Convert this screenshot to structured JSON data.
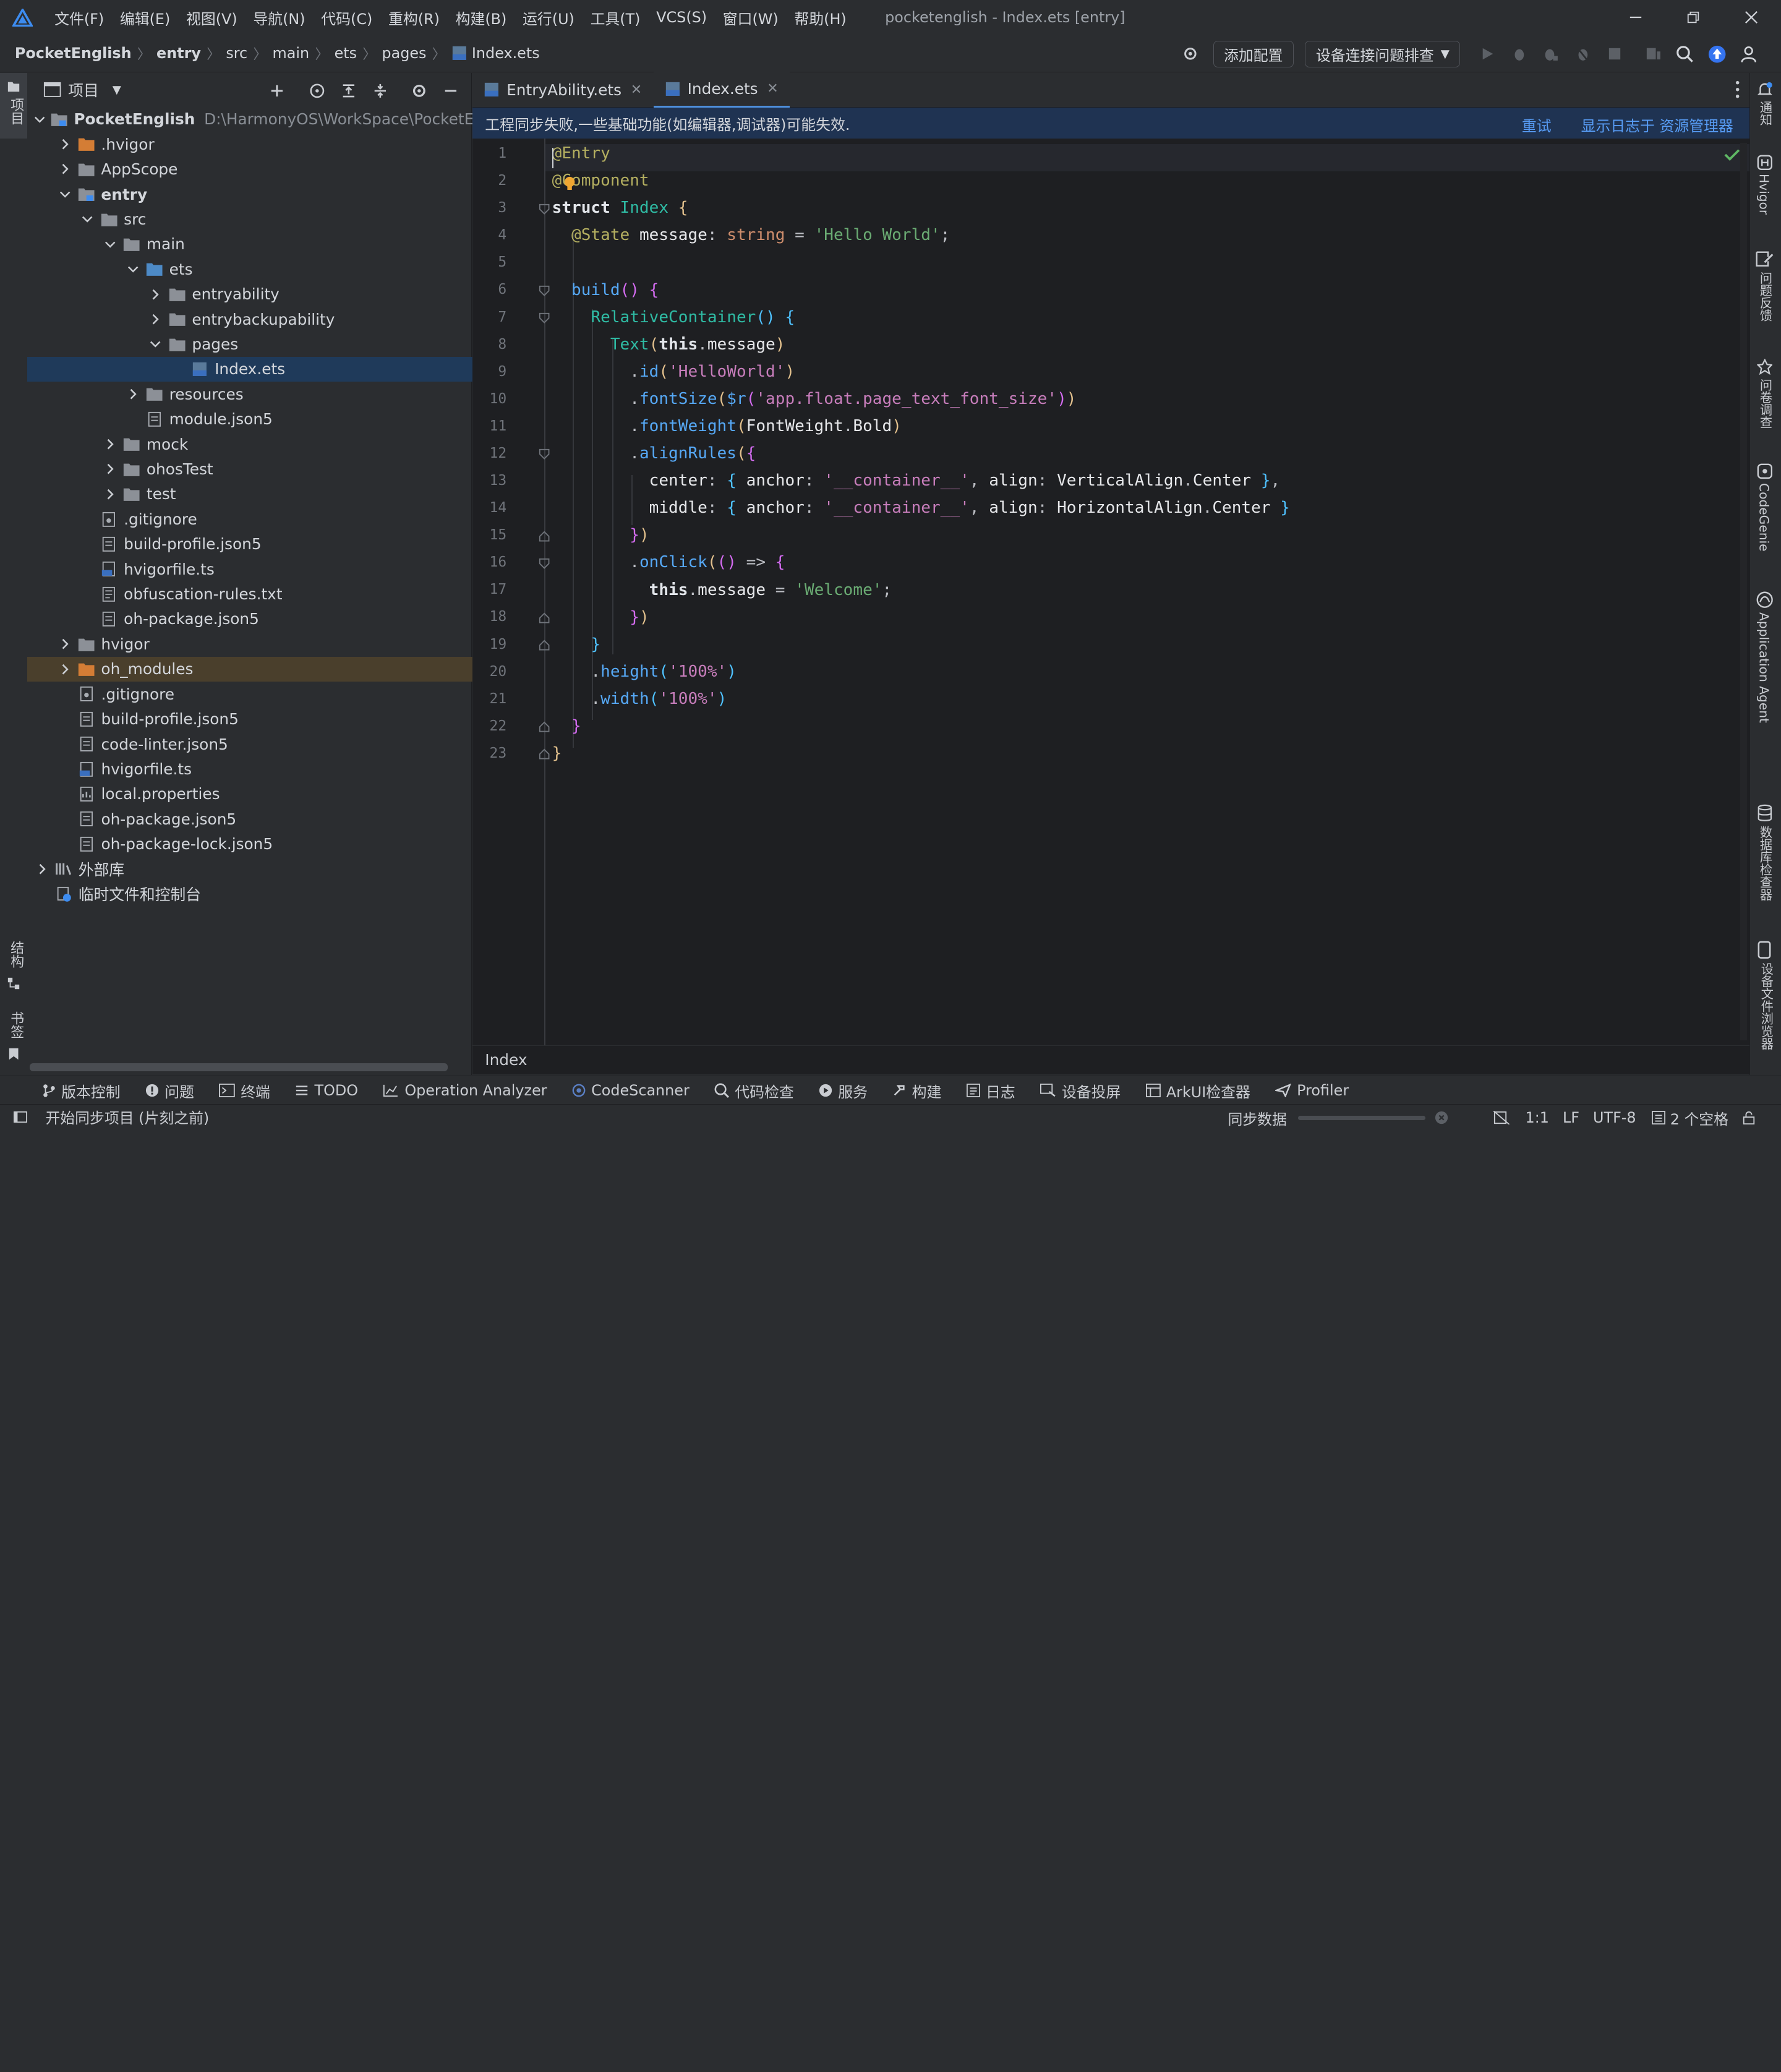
{
  "window": {
    "title": "pocketenglish - Index.ets [entry]"
  },
  "menu": [
    "文件(F)",
    "编辑(E)",
    "视图(V)",
    "导航(N)",
    "代码(C)",
    "重构(R)",
    "构建(B)",
    "运行(U)",
    "工具(T)",
    "VCS(S)",
    "窗口(W)",
    "帮助(H)"
  ],
  "breadcrumb": [
    "PocketEnglish",
    "entry",
    "src",
    "main",
    "ets",
    "pages",
    "Index.ets"
  ],
  "toolbar": {
    "add_config": "添加配置",
    "device_troubleshoot": "设备连接问题排查"
  },
  "left_strip": {
    "project": "项目",
    "structure": "结构",
    "bookmarks": "书签"
  },
  "project_panel": {
    "title": "项目",
    "tree": [
      {
        "label": "PocketEnglish",
        "path": "D:\\HarmonyOS\\WorkSpace\\PocketEngl"
      },
      {
        "label": ".hvigor"
      },
      {
        "label": "AppScope"
      },
      {
        "label": "entry"
      },
      {
        "label": "src"
      },
      {
        "label": "main"
      },
      {
        "label": "ets"
      },
      {
        "label": "entryability"
      },
      {
        "label": "entrybackupability"
      },
      {
        "label": "pages"
      },
      {
        "label": "Index.ets"
      },
      {
        "label": "resources"
      },
      {
        "label": "module.json5"
      },
      {
        "label": "mock"
      },
      {
        "label": "ohosTest"
      },
      {
        "label": "test"
      },
      {
        "label": ".gitignore"
      },
      {
        "label": "build-profile.json5"
      },
      {
        "label": "hvigorfile.ts"
      },
      {
        "label": "obfuscation-rules.txt"
      },
      {
        "label": "oh-package.json5"
      },
      {
        "label": "hvigor"
      },
      {
        "label": "oh_modules"
      },
      {
        "label": ".gitignore"
      },
      {
        "label": "build-profile.json5"
      },
      {
        "label": "code-linter.json5"
      },
      {
        "label": "hvigorfile.ts"
      },
      {
        "label": "local.properties"
      },
      {
        "label": "oh-package.json5"
      },
      {
        "label": "oh-package-lock.json5"
      },
      {
        "label": "外部库"
      },
      {
        "label": "临时文件和控制台"
      }
    ]
  },
  "tabs": [
    {
      "label": "EntryAbility.ets"
    },
    {
      "label": "Index.ets"
    }
  ],
  "notice": {
    "text": "工程同步失败,一些基础功能(如编辑器,调试器)可能失效.",
    "retry": "重试",
    "show_log": "显示日志于 资源管理器"
  },
  "editor": {
    "line_numbers": [
      "1",
      "2",
      "3",
      "4",
      "5",
      "6",
      "7",
      "8",
      "9",
      "10",
      "11",
      "12",
      "13",
      "14",
      "15",
      "16",
      "17",
      "18",
      "19",
      "20",
      "21",
      "22",
      "23"
    ],
    "footer_crumb": "Index"
  },
  "right_strip": [
    "通知",
    "Hvigor",
    "问题反馈",
    "问卷调查",
    "CodeGenie",
    "Application Agent",
    "数据库检查器",
    "设备文件浏览器"
  ],
  "bottom_tools": [
    "版本控制",
    "问题",
    "终端",
    "TODO",
    "Operation Analyzer",
    "CodeScanner",
    "代码检查",
    "服务",
    "构建",
    "日志",
    "设备投屏",
    "ArkUI检查器",
    "Profiler"
  ],
  "status": {
    "left": "开始同步项目 (片刻之前)",
    "sync": "同步数据",
    "position": "1:1",
    "line_sep": "LF",
    "encoding": "UTF-8",
    "indent": "2 个空格"
  },
  "colors": {
    "selection": "#1f3a5a",
    "accent": "#4e8fdb",
    "notice_bg": "#1f3352",
    "editor_bg": "#1e1f22",
    "panel_bg": "#2b2d30"
  }
}
